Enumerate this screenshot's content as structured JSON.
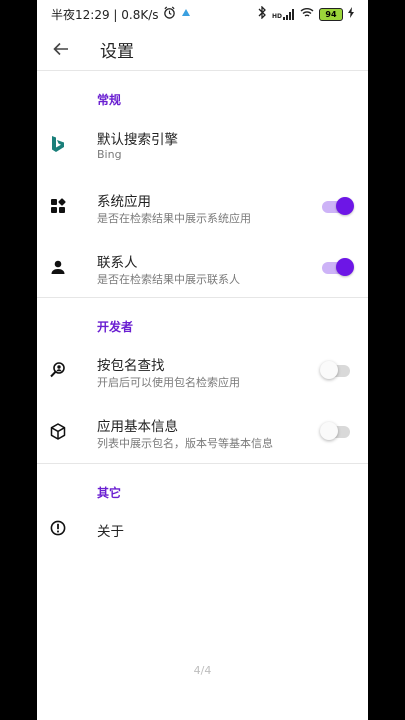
{
  "status_bar": {
    "time": "半夜12:29 | 0.8K/s",
    "signal_label": "HD",
    "battery": "94"
  },
  "app_bar": {
    "title": "设置"
  },
  "sections": [
    {
      "header": "常规",
      "items": [
        {
          "title": "默认搜索引擎",
          "subtitle": "Bing",
          "icon": "bing-icon"
        },
        {
          "title": "系统应用",
          "subtitle": "是否在检索结果中展示系统应用",
          "icon": "apps-grid-icon",
          "toggle": true
        },
        {
          "title": "联系人",
          "subtitle": "是否在检索结果中展示联系人",
          "icon": "person-icon",
          "toggle": true
        }
      ]
    },
    {
      "header": "开发者",
      "items": [
        {
          "title": "按包名查找",
          "subtitle": "开启后可以使用包名检索应用",
          "icon": "person-search-icon",
          "toggle": false
        },
        {
          "title": "应用基本信息",
          "subtitle": "列表中展示包名，版本号等基本信息",
          "icon": "package-icon",
          "toggle": false
        }
      ]
    },
    {
      "header": "其它",
      "items": [
        {
          "title": "关于",
          "icon": "info-icon"
        }
      ]
    }
  ],
  "pager": "4/4",
  "colors": {
    "accent": "#6d16e6",
    "accent_track": "#cdb3f7",
    "section_header": "#6a1fd1",
    "bing": "#1a7f7a"
  }
}
